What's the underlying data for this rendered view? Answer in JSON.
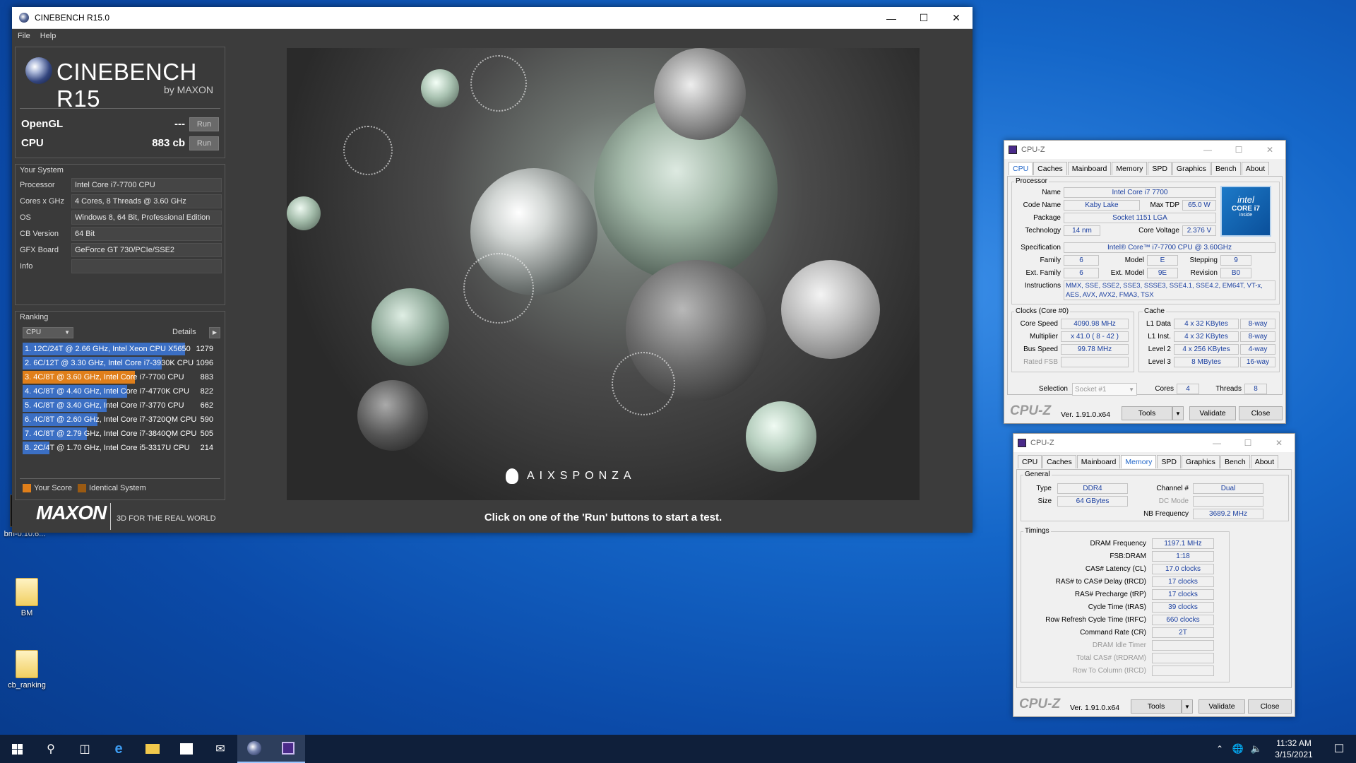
{
  "desktop": {
    "icons": [
      {
        "label": "bm-0.10.6..."
      },
      {
        "label": "BM"
      },
      {
        "label": "cb_ranking"
      }
    ]
  },
  "cinebench": {
    "title": "CINEBENCH R15.0",
    "menu": [
      "File",
      "Help"
    ],
    "logo": "CINEBENCH R15",
    "logo_sub": "by MAXON",
    "opengl_label": "OpenGL",
    "opengl_value": "---",
    "cpu_label": "CPU",
    "cpu_value": "883 cb",
    "run_label": "Run",
    "your_system": "Your System",
    "system": [
      {
        "k": "Processor",
        "v": "Intel Core i7-7700 CPU"
      },
      {
        "k": "Cores x GHz",
        "v": "4 Cores, 8 Threads @ 3.60 GHz"
      },
      {
        "k": "OS",
        "v": "Windows 8, 64 Bit, Professional Edition"
      },
      {
        "k": "CB Version",
        "v": "64 Bit"
      },
      {
        "k": "GFX Board",
        "v": "GeForce GT 730/PCIe/SSE2"
      },
      {
        "k": "Info",
        "v": ""
      }
    ],
    "ranking_title": "Ranking",
    "ranking_select": "CPU",
    "details_label": "Details",
    "ranking": [
      {
        "label": "1. 12C/24T @ 2.66 GHz, Intel Xeon CPU X5650",
        "score": "1279",
        "fill": 1.0,
        "color": "#3b6fc4"
      },
      {
        "label": "2. 6C/12T @ 3.30 GHz,  Intel Core i7-3930K CPU",
        "score": "1096",
        "fill": 0.857,
        "color": "#3b6fc4"
      },
      {
        "label": "3. 4C/8T @ 3.60 GHz, Intel Core i7-7700 CPU",
        "score": "883",
        "fill": 0.69,
        "color": "#e07f1a"
      },
      {
        "label": "4. 4C/8T @ 4.40 GHz, Intel Core i7-4770K CPU",
        "score": "822",
        "fill": 0.643,
        "color": "#3b6fc4"
      },
      {
        "label": "5. 4C/8T @ 3.40 GHz,  Intel Core i7-3770 CPU",
        "score": "662",
        "fill": 0.518,
        "color": "#3b6fc4"
      },
      {
        "label": "6. 4C/8T @ 2.60 GHz, Intel Core i7-3720QM CPU",
        "score": "590",
        "fill": 0.461,
        "color": "#3b6fc4"
      },
      {
        "label": "7. 4C/8T @ 2.79 GHz,  Intel Core i7-3840QM CPU",
        "score": "505",
        "fill": 0.395,
        "color": "#3b6fc4"
      },
      {
        "label": "8. 2C/4T @ 1.70 GHz,  Intel Core i5-3317U CPU",
        "score": "214",
        "fill": 0.167,
        "color": "#3b6fc4"
      }
    ],
    "legend_your": "Your Score",
    "legend_identical": "Identical System",
    "maxon": "MAXON",
    "tagline": "3D FOR THE REAL WORLD",
    "render_brand": "AIXSPONZA",
    "status": "Click on one of the 'Run' buttons to start a test."
  },
  "cpuz1": {
    "title": "CPU-Z",
    "tabs": [
      "CPU",
      "Caches",
      "Mainboard",
      "Memory",
      "SPD",
      "Graphics",
      "Bench",
      "About"
    ],
    "processor": "Processor",
    "name_l": "Name",
    "name": "Intel Core i7 7700",
    "codename_l": "Code Name",
    "codename": "Kaby Lake",
    "maxtdp_l": "Max TDP",
    "maxtdp": "65.0 W",
    "package_l": "Package",
    "package": "Socket 1151 LGA",
    "tech_l": "Technology",
    "tech": "14 nm",
    "cv_l": "Core Voltage",
    "cv": "2.376 V",
    "spec_l": "Specification",
    "spec": "Intel® Core™ i7-7700 CPU @ 3.60GHz",
    "family_l": "Family",
    "family": "6",
    "model_l": "Model",
    "model": "E",
    "stepping_l": "Stepping",
    "stepping": "9",
    "extfam_l": "Ext. Family",
    "extfam": "6",
    "extmod_l": "Ext. Model",
    "extmod": "9E",
    "rev_l": "Revision",
    "rev": "B0",
    "instr_l": "Instructions",
    "instr1": "MMX, SSE, SSE2, SSE3, SSSE3, SSE4.1, SSE4.2, EM64T, VT-x,",
    "instr2": "AES, AVX, AVX2, FMA3, TSX",
    "clocks": "Clocks (Core #0)",
    "cs_l": "Core Speed",
    "cs": "4090.98 MHz",
    "mult_l": "Multiplier",
    "mult": "x 41.0 ( 8 - 42 )",
    "bus_l": "Bus Speed",
    "bus": "99.78 MHz",
    "fsb_l": "Rated FSB",
    "cache": "Cache",
    "l1d_l": "L1 Data",
    "l1d": "4 x 32 KBytes",
    "l1d_w": "8-way",
    "l1i_l": "L1 Inst.",
    "l1i": "4 x 32 KBytes",
    "l1i_w": "8-way",
    "l2_l": "Level 2",
    "l2": "4 x 256 KBytes",
    "l2_w": "4-way",
    "l3_l": "Level 3",
    "l3": "8 MBytes",
    "l3_w": "16-way",
    "sel_l": "Selection",
    "sel": "Socket #1",
    "cores_l": "Cores",
    "cores": "4",
    "threads_l": "Threads",
    "threads": "8",
    "intel_badge_1": "intel",
    "intel_badge_2": "CORE i7",
    "intel_badge_3": "inside",
    "logo": "CPU-Z",
    "ver": "Ver. 1.91.0.x64",
    "tools": "Tools",
    "validate": "Validate",
    "close": "Close"
  },
  "cpuz2": {
    "title": "CPU-Z",
    "tabs": [
      "CPU",
      "Caches",
      "Mainboard",
      "Memory",
      "SPD",
      "Graphics",
      "Bench",
      "About"
    ],
    "general": "General",
    "type_l": "Type",
    "type": "DDR4",
    "size_l": "Size",
    "size": "64 GBytes",
    "channel_l": "Channel #",
    "channel": "Dual",
    "dcmode_l": "DC Mode",
    "nbf_l": "NB Frequency",
    "nbf": "3689.2 MHz",
    "timings": "Timings",
    "rows": [
      {
        "k": "DRAM Frequency",
        "v": "1197.1 MHz",
        "dim": false
      },
      {
        "k": "FSB:DRAM",
        "v": "1:18",
        "dim": false
      },
      {
        "k": "CAS# Latency (CL)",
        "v": "17.0 clocks",
        "dim": false
      },
      {
        "k": "RAS# to CAS# Delay (tRCD)",
        "v": "17 clocks",
        "dim": false
      },
      {
        "k": "RAS# Precharge (tRP)",
        "v": "17 clocks",
        "dim": false
      },
      {
        "k": "Cycle Time (tRAS)",
        "v": "39 clocks",
        "dim": false
      },
      {
        "k": "Row Refresh Cycle Time (tRFC)",
        "v": "660 clocks",
        "dim": false
      },
      {
        "k": "Command Rate (CR)",
        "v": "2T",
        "dim": false
      },
      {
        "k": "DRAM Idle Timer",
        "v": "",
        "dim": true
      },
      {
        "k": "Total CAS# (tRDRAM)",
        "v": "",
        "dim": true
      },
      {
        "k": "Row To Column (tRCD)",
        "v": "",
        "dim": true
      }
    ],
    "logo": "CPU-Z",
    "ver": "Ver. 1.91.0.x64",
    "tools": "Tools",
    "validate": "Validate",
    "close": "Close"
  },
  "taskbar": {
    "time": "11:32 AM",
    "date": "3/15/2021"
  }
}
